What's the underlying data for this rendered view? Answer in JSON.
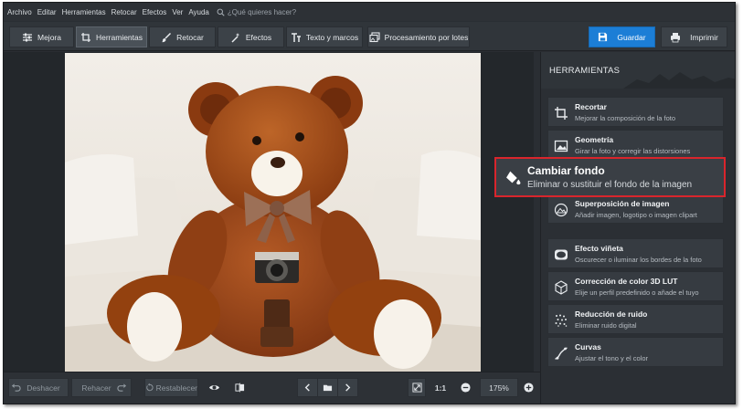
{
  "menu": [
    "Archivo",
    "Editar",
    "Herramientas",
    "Retocar",
    "Efectos",
    "Ver",
    "Ayuda"
  ],
  "search": {
    "placeholder": "¿Qué quieres hacer?"
  },
  "tabs": [
    {
      "label": "Mejora",
      "icon": "sliders-icon"
    },
    {
      "label": "Herramientas",
      "icon": "crop-icon",
      "active": true
    },
    {
      "label": "Retocar",
      "icon": "brush-icon"
    },
    {
      "label": "Efectos",
      "icon": "magic-wand-icon"
    },
    {
      "label": "Texto y marcos",
      "icon": "text-icon"
    },
    {
      "label": "Procesamiento por lotes",
      "icon": "batch-icon"
    }
  ],
  "actions": {
    "save": "Guardar",
    "print": "Imprimir"
  },
  "colors": {
    "accent": "#1c7ed6",
    "highlight_border": "#d9252c",
    "background": "#2a2e33"
  },
  "panel": {
    "title": "HERRAMIENTAS",
    "tools": [
      {
        "title": "Recortar",
        "desc": "Mejorar la composición de la foto",
        "icon": "crop-icon"
      },
      {
        "title": "Geometría",
        "desc": "Girar la foto y corregir las distorsiones",
        "icon": "geometry-icon"
      },
      {
        "title": "Cambiar fondo",
        "desc": "Eliminar o sustituir el fondo de la imagen",
        "icon": "paint-bucket-icon",
        "highlighted": true
      },
      {
        "title": "Superposición de imagen",
        "desc": "Añadir imagen, logotipo o imagen clipart",
        "icon": "overlay-icon"
      },
      {
        "title": "Efecto viñeta",
        "desc": "Oscurecer o iluminar los bordes de la foto",
        "icon": "vignette-icon"
      },
      {
        "title": "Corrección de color 3D LUT",
        "desc": "Elije un perfil predefinido o añade el tuyo",
        "icon": "lut-cube-icon"
      },
      {
        "title": "Reducción de ruido",
        "desc": "Eliminar ruido digital",
        "icon": "noise-icon"
      },
      {
        "title": "Curvas",
        "desc": "Ajustar el tono y el color",
        "icon": "curves-icon"
      }
    ]
  },
  "bottom": {
    "undo": "Deshacer",
    "redo": "Rehacer",
    "reset": "Restablecer",
    "ratio": "1:1",
    "zoom": "175%"
  }
}
